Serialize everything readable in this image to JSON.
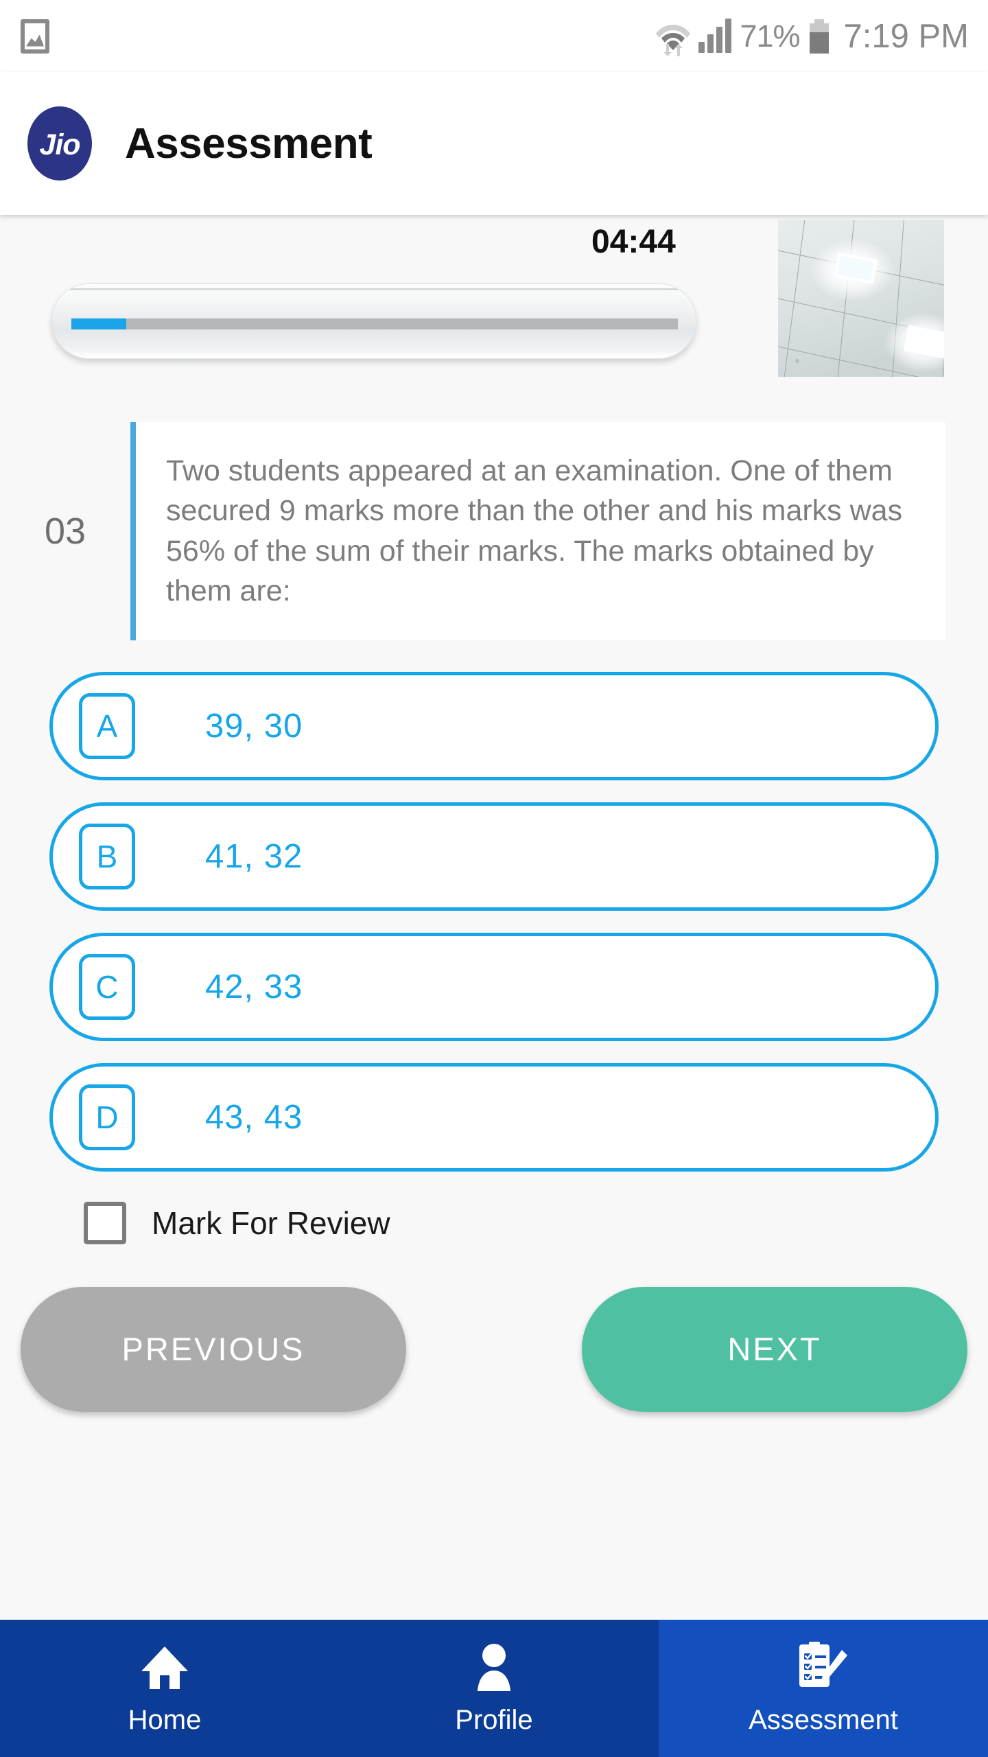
{
  "status_bar": {
    "gallery_icon": "image-icon",
    "wifi_icon": "wifi-icon",
    "data_transfer_icon": "data-transfer-arrows-icon",
    "signal_icon": "cellular-signal-icon",
    "battery_percent": "71%",
    "battery_icon": "battery-icon",
    "time": "7:19 PM"
  },
  "header": {
    "logo_text": "Jio",
    "logo_color": "#2b3485",
    "title": "Assessment"
  },
  "exam": {
    "timer": "04:44",
    "progress_percent": 9,
    "camera_preview_label": "camera-preview",
    "question_number": "03",
    "question_text": "Two students appeared at an examination. One of them secured 9 marks more than the other and his marks was 56% of the sum of their marks. The marks obtained by them are:",
    "accent_color": "#4aa8dd",
    "option_color": "#17a6e8",
    "options": [
      {
        "letter": "A",
        "text": "39, 30"
      },
      {
        "letter": "B",
        "text": "41, 32"
      },
      {
        "letter": "C",
        "text": "42, 33"
      },
      {
        "letter": "D",
        "text": "43, 43"
      }
    ],
    "mark_for_review_label": "Mark For Review",
    "mark_for_review_checked": false,
    "previous_label": "PREVIOUS",
    "next_label": "NEXT",
    "previous_color": "#acacac",
    "next_color": "#4fc0a1"
  },
  "bottom_nav": {
    "items": [
      {
        "label": "Home",
        "icon": "home-icon",
        "active": false
      },
      {
        "label": "Profile",
        "icon": "person-icon",
        "active": false
      },
      {
        "label": "Assessment",
        "icon": "clipboard-pencil-icon",
        "active": true
      }
    ],
    "background": "#0d3c96",
    "active_background": "#1350bd"
  }
}
